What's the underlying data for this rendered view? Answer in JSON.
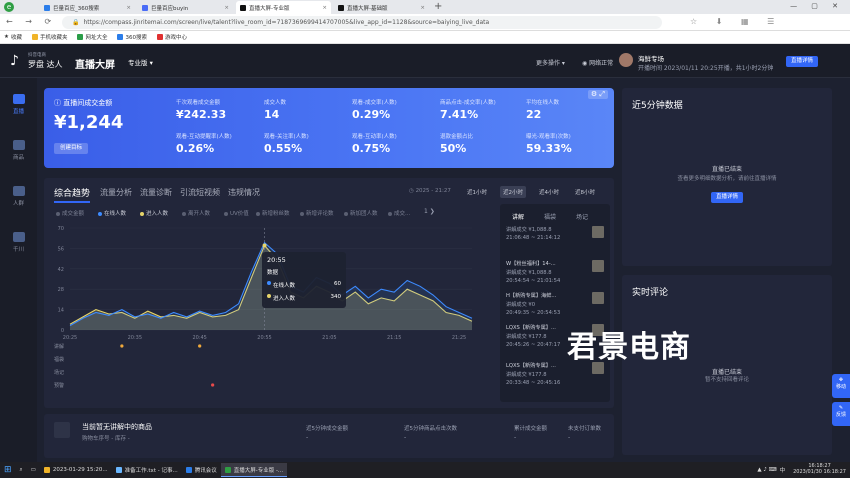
{
  "browser": {
    "tabs": [
      {
        "label": "巨量百应_360搜索",
        "color": "#2b7de9"
      },
      {
        "label": "巨量百应buyin",
        "color": "#4a6cf7"
      },
      {
        "label": "直播大屏-专业版",
        "color": "#111111"
      },
      {
        "label": "直播大屏-基础版",
        "color": "#111111"
      }
    ],
    "url": "https://compass.jinritemai.com/screen/live/talent?live_room_id=7187369699414707005&live_app_id=1128&source=baiying_live_data",
    "bookmarks": [
      "收藏",
      "手机收藏夹",
      "网址大全",
      "360搜索",
      "游戏中心"
    ]
  },
  "app": {
    "logo_small": "抖音电商",
    "logo": "罗盘 达人",
    "title": "直播大屏",
    "edition": "专业版",
    "more_ops": "更多操作",
    "network": "网络正常",
    "anchor_name": "海鲜专场",
    "start_info": "开播时间 2023/01/11 20:25开播，共1小时2分钟",
    "detail_btn": "直播详情"
  },
  "sidebar": [
    "直播",
    "商品",
    "人群",
    "千川"
  ],
  "kpi": {
    "main_label": "直播间成交金额",
    "main_value": "¥1,244",
    "main_btn": "创建目标",
    "items": [
      {
        "label": "千次观看成交金额",
        "value": "¥242.33"
      },
      {
        "label": "成交人数",
        "value": "14"
      },
      {
        "label": "观看-成交率(人数)",
        "value": "0.29%"
      },
      {
        "label": "商品点击-成交率(人数)",
        "value": "7.41%"
      },
      {
        "label": "平均在线人数",
        "value": "22"
      },
      {
        "label": "观看-互动提醒率(人数)",
        "value": "0.26%"
      },
      {
        "label": "观看-关注率(人数)",
        "value": "0.55%"
      },
      {
        "label": "观看-互动率(人数)",
        "value": "0.75%"
      },
      {
        "label": "退款金额占比",
        "value": "50%"
      },
      {
        "label": "曝光-观看率(次数)",
        "value": "59.33%"
      }
    ]
  },
  "chart_tabs": [
    "综合趋势",
    "流量分析",
    "流量诊断",
    "引流短视频",
    "违规情况"
  ],
  "time_range": "2025 - 21:27",
  "time_buttons": [
    "近1小时",
    "近2小时",
    "近4小时",
    "近8小时"
  ],
  "legend": [
    "成交金额",
    "在线人数",
    "进入人数",
    "离开人数",
    "UV价值",
    "新增粉丝数",
    "新增评论数",
    "新加团人数",
    "成交..."
  ],
  "event_rows": [
    "讲解",
    "福袋",
    "场记",
    "预警"
  ],
  "event_tabs": [
    "讲解",
    "福袋",
    "场记"
  ],
  "events": [
    {
      "title": "",
      "l1": "讲解成交 ¥1,088.8",
      "l2": "21:06:48 ~ 21:14:12"
    },
    {
      "title": "W【粉丝福利】14-...",
      "l1": "讲解成交 ¥1,088.8",
      "l2": "20:54:54 ~ 21:01:54"
    },
    {
      "title": "H【新购专属】海鲜...",
      "l1": "讲解成交 ¥0",
      "l2": "20:49:35 ~ 20:54:53"
    },
    {
      "title": "LQXS【新购专属】...",
      "l1": "讲解成交 ¥177.8",
      "l2": "20:45:26 ~ 20:47:17"
    },
    {
      "title": "LQXS【新购专属】...",
      "l1": "讲解成交 ¥177.8",
      "l2": "20:33:48 ~ 20:45:16"
    }
  ],
  "tooltip": {
    "time": "20:55",
    "title": "数据",
    "rows": [
      {
        "label": "在线人数",
        "value": "60"
      },
      {
        "label": "进入人数",
        "value": "340"
      }
    ]
  },
  "chart_data": {
    "type": "line",
    "x": [
      "20:25",
      "20:27",
      "20:29",
      "20:31",
      "20:33",
      "20:35",
      "20:37",
      "20:39",
      "20:41",
      "20:43",
      "20:45",
      "20:47",
      "20:49",
      "20:51",
      "20:53",
      "20:55",
      "20:57",
      "20:59",
      "21:01",
      "21:03",
      "21:05",
      "21:07",
      "21:09",
      "21:11",
      "21:13",
      "21:15",
      "21:17",
      "21:19",
      "21:21",
      "21:23",
      "21:25",
      "21:27"
    ],
    "x_ticks": [
      "20:25",
      "20:35",
      "20:45",
      "20:55",
      "21:05",
      "21:15",
      "21:25"
    ],
    "y_ticks": [
      0,
      14,
      28,
      42,
      56,
      70
    ],
    "ylim": [
      0,
      70
    ],
    "series": [
      {
        "name": "在线人数",
        "color": "#3d8bff",
        "values": [
          3,
          8,
          12,
          10,
          14,
          9,
          11,
          8,
          12,
          9,
          13,
          10,
          12,
          18,
          40,
          60,
          52,
          30,
          26,
          36,
          32,
          24,
          30,
          22,
          28,
          26,
          34,
          30,
          24,
          16,
          12,
          8
        ]
      },
      {
        "name": "进入人数",
        "color": "#e6d46a",
        "values": [
          4,
          9,
          14,
          11,
          12,
          8,
          13,
          9,
          10,
          8,
          12,
          9,
          10,
          14,
          36,
          58,
          48,
          26,
          22,
          30,
          26,
          20,
          26,
          18,
          22,
          20,
          28,
          24,
          20,
          12,
          10,
          6
        ]
      }
    ],
    "markers": {
      "讲解": [
        "20:33",
        "20:45",
        "20:50",
        "20:56",
        "21:08",
        "21:16",
        "21:24"
      ],
      "预警": [
        "20:47"
      ]
    }
  },
  "right1": {
    "title": "近5分钟数据",
    "empty1": "直播已结束",
    "empty2": "查看更多明细数据分析，请前往直播详情",
    "btn": "直播详情"
  },
  "right2": {
    "title": "实时评论",
    "empty1": "直播已结束",
    "empty2": "暂不支持回看评论"
  },
  "bottom": {
    "title": "当前暂无讲解中的商品",
    "sub": "购物车序号",
    "sub2": "库存",
    "cols": [
      {
        "label": "近5分钟成交金额",
        "value": "-"
      },
      {
        "label": "近5分钟商品点击次数",
        "value": "-"
      },
      {
        "label": "累计成交金额",
        "value": "-"
      },
      {
        "label": "未支付订单数",
        "value": "-"
      }
    ]
  },
  "watermark": "君景电商",
  "float": [
    "移动",
    "反馈"
  ],
  "taskbar": {
    "items": [
      "2023-01-29 15:20...",
      "准备工作.txt - 记事...",
      "腾讯会议",
      "直播大屏-专业版 -..."
    ],
    "tray": "中",
    "time": "16:18:27",
    "date": "2023/01/30 16:18:27"
  }
}
